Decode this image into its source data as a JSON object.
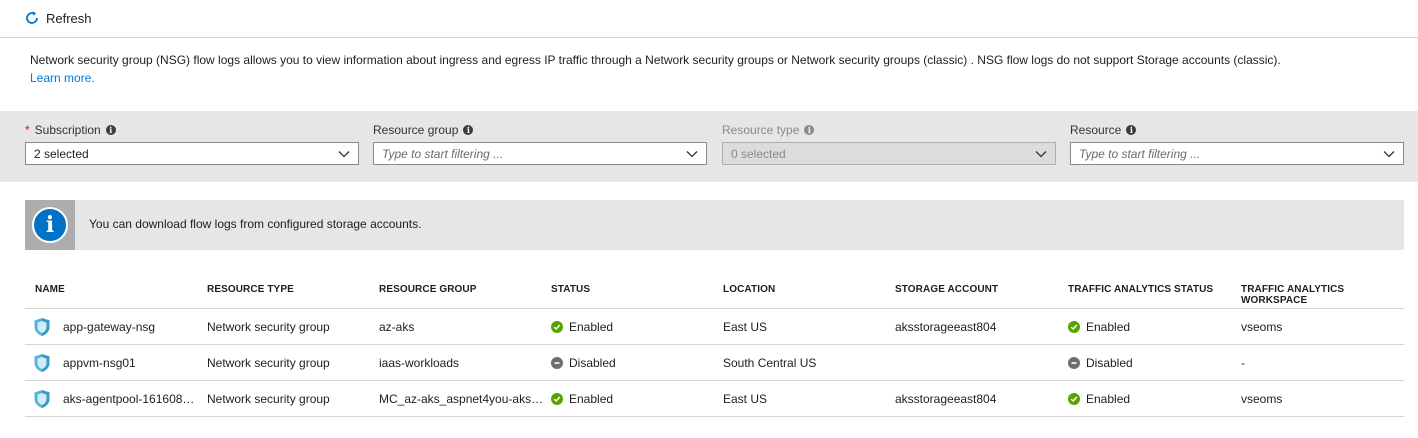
{
  "toolbar": {
    "refresh_label": "Refresh",
    "refresh_icon": "refresh-icon"
  },
  "description": {
    "text": "Network security group (NSG) flow logs allows you to view information about ingress and egress IP traffic through a Network security groups or Network security groups (classic) . NSG flow logs do not support Storage accounts (classic).",
    "learn_more": "Learn more."
  },
  "filters": {
    "subscription": {
      "label": "Subscription",
      "value": "2 selected",
      "required_mark": "*"
    },
    "resource_group": {
      "label": "Resource group",
      "placeholder": "Type to start filtering ..."
    },
    "resource_type": {
      "label": "Resource type",
      "value": "0 selected"
    },
    "resource": {
      "label": "Resource",
      "placeholder": "Type to start filtering ..."
    }
  },
  "banner": {
    "message": "You can download flow logs from configured storage accounts."
  },
  "table": {
    "headers": [
      "NAME",
      "RESOURCE TYPE",
      "RESOURCE GROUP",
      "STATUS",
      "LOCATION",
      "STORAGE ACCOUNT",
      "TRAFFIC ANALYTICS STATUS",
      "TRAFFIC ANALYTICS WORKSPACE"
    ],
    "rows": [
      {
        "name": "app-gateway-nsg",
        "type": "Network security group",
        "group": "az-aks",
        "status": "Enabled",
        "location": "East US",
        "storage": "aksstorageeast804",
        "ta_status": "Enabled",
        "workspace": "vseoms"
      },
      {
        "name": "appvm-nsg01",
        "type": "Network security group",
        "group": "iaas-workloads",
        "status": "Disabled",
        "location": "South Central US",
        "storage": "",
        "ta_status": "Disabled",
        "workspace": "-"
      },
      {
        "name": "aks-agentpool-161608…",
        "type": "Network security group",
        "group": "MC_az-aks_aspnet4you-aks…",
        "status": "Enabled",
        "location": "East US",
        "storage": "aksstorageeast804",
        "ta_status": "Enabled",
        "workspace": "vseoms"
      }
    ]
  },
  "colors": {
    "accent": "#0078d4",
    "enabled": "#57a300",
    "disabled": "#6e6e6e",
    "required": "#e00b1c"
  }
}
